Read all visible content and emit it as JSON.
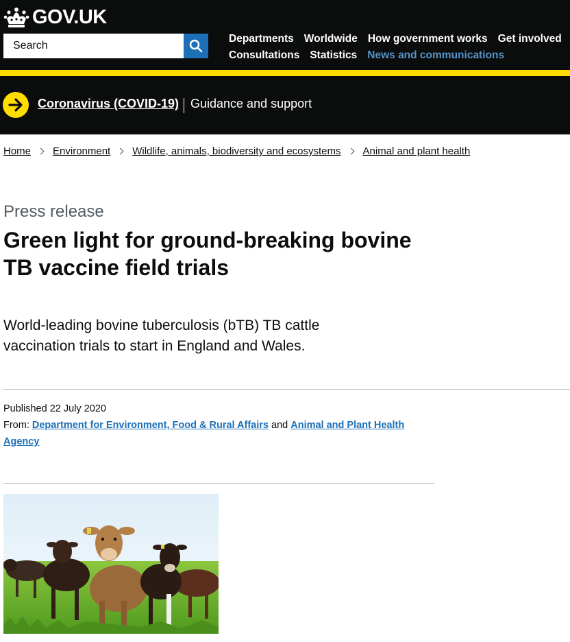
{
  "header": {
    "logo_text": "GOV.UK",
    "search": {
      "placeholder": "Search"
    },
    "nav_row1": [
      "Departments",
      "Worldwide",
      "How government works",
      "Get involved"
    ],
    "nav_row2": [
      "Consultations",
      "Statistics",
      "News and communications"
    ]
  },
  "covid_banner": {
    "link": "Coronavirus (COVID-19)",
    "text": "Guidance and support"
  },
  "breadcrumbs": [
    "Home",
    "Environment",
    "Wildlife, animals, biodiversity and ecosystems",
    "Animal and plant health"
  ],
  "article": {
    "caption": "Press release",
    "title": "Green light for ground-breaking bovine TB vaccine field trials",
    "lead": "World-leading bovine tuberculosis (bTB) TB cattle vaccination trials to start in England and Wales.",
    "published_label": "Published",
    "published_date": "22 July 2020",
    "from_label": "From:",
    "from_org1": "Department for Environment, Food & Rural Affairs",
    "from_and": "and",
    "from_org2": "Animal and Plant Health Agency"
  },
  "colors": {
    "header_bg": "#0b0c0c",
    "accent_yellow": "#ffdd00",
    "link_blue": "#1d70b8"
  }
}
